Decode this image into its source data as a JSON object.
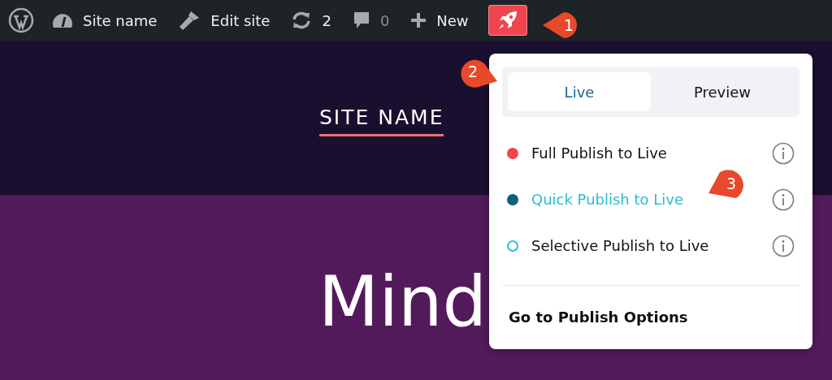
{
  "admin_bar": {
    "items": [
      {
        "kind": "wp"
      },
      {
        "kind": "dashboard",
        "label": "Site name"
      },
      {
        "kind": "brush",
        "label": "Edit site"
      },
      {
        "kind": "updates",
        "label": "2"
      },
      {
        "kind": "comments",
        "label": "0"
      },
      {
        "kind": "new",
        "label": "New"
      },
      {
        "kind": "rocket",
        "selected": true
      }
    ]
  },
  "site": {
    "name": "SITE NAME",
    "hero": "Mind"
  },
  "menu": {
    "tabs": [
      {
        "label": "Live",
        "selected": true
      },
      {
        "label": "Preview",
        "selected": false
      }
    ],
    "items": [
      {
        "label": "Full Publish to Live",
        "kind": "filled",
        "color": "#f0444e",
        "selected": false
      },
      {
        "label": "Quick Publish to Live",
        "kind": "filled",
        "color": "#0b5f7c",
        "selected": true
      },
      {
        "label": "Selective Publish to Live",
        "kind": "ring",
        "color": "#2bc0d8",
        "selected": false
      }
    ],
    "footer": "Go to Publish Options"
  },
  "callouts": [
    {
      "label": "1",
      "kind": "left"
    },
    {
      "label": "2",
      "kind": "right"
    },
    {
      "label": "3",
      "kind": "down-left"
    }
  ]
}
